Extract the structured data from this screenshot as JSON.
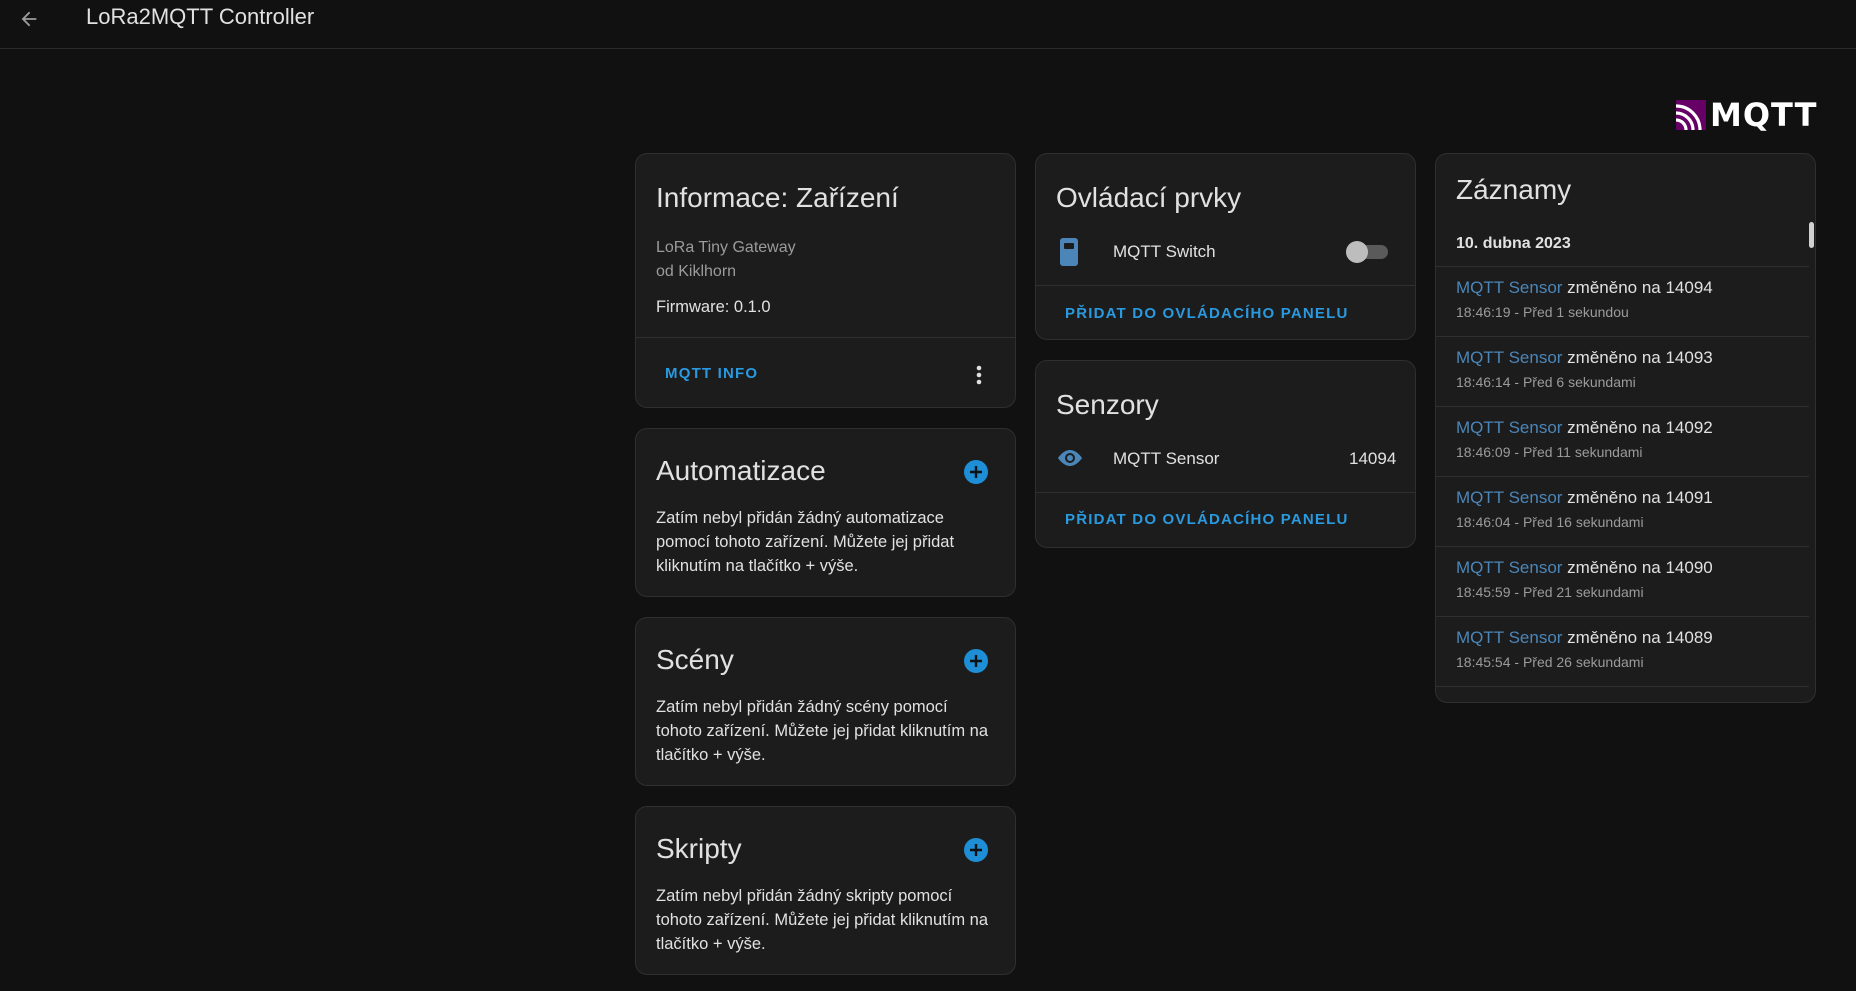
{
  "header": {
    "title": "LoRa2MQTT Controller",
    "back_icon": "arrow-left-icon"
  },
  "logo": {
    "text": "MQTT",
    "colors": [
      "#660066",
      "#ffffff"
    ]
  },
  "device_info": {
    "title": "Informace: Zařízení",
    "model": "LoRa Tiny Gateway",
    "manufacturer": "od Kiklhorn",
    "firmware": "Firmware: 0.1.0",
    "action": "MQTT INFO",
    "menu_icon": "more-vertical-icon"
  },
  "automations": {
    "title": "Automatizace",
    "text": "Zatím nebyl přidán žádný automatizace pomocí tohoto zařízení. Můžete jej přidat kliknutím na tlačítko + výše."
  },
  "scenes": {
    "title": "Scény",
    "text": "Zatím nebyl přidán žádný scény pomocí tohoto zařízení. Můžete jej přidat kliknutím na tlačítko + výše."
  },
  "scripts": {
    "title": "Skripty",
    "text": "Zatím nebyl přidán žádný skripty pomocí tohoto zařízení. Můžete jej přidat kliknutím na tlačítko + výše."
  },
  "controls": {
    "title": "Ovládací prvky",
    "switch_label": "MQTT Switch",
    "switch_on": false,
    "action": "PŘIDAT DO OVLÁDACÍHO PANELU"
  },
  "sensors": {
    "title": "Senzory",
    "sensor_label": "MQTT Sensor",
    "sensor_value": "14094",
    "action": "PŘIDAT DO OVLÁDACÍHO PANELU"
  },
  "logbook": {
    "title": "Záznamy",
    "date": "10. dubna 2023",
    "entries": [
      {
        "entity": "MQTT Sensor",
        "message": "změněno na 14094",
        "time": "18:46:19 - Před 1 sekundou"
      },
      {
        "entity": "MQTT Sensor",
        "message": "změněno na 14093",
        "time": "18:46:14 - Před 6 sekundami"
      },
      {
        "entity": "MQTT Sensor",
        "message": "změněno na 14092",
        "time": "18:46:09 - Před 11 sekundami"
      },
      {
        "entity": "MQTT Sensor",
        "message": "změněno na 14091",
        "time": "18:46:04 - Před 16 sekundami"
      },
      {
        "entity": "MQTT Sensor",
        "message": "změněno na 14090",
        "time": "18:45:59 - Před 21 sekundami"
      },
      {
        "entity": "MQTT Sensor",
        "message": "změněno na 14089",
        "time": "18:45:54 - Před 26 sekundami"
      }
    ]
  }
}
